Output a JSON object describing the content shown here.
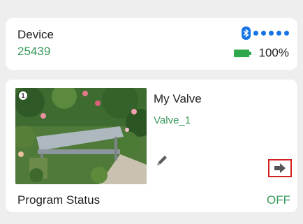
{
  "device": {
    "label": "Device",
    "id": "25439",
    "signal_bars": 5,
    "battery_level": "100%"
  },
  "valve": {
    "photo_badge": "1",
    "name": "My Valve",
    "id": "Valve_1",
    "program_status_label": "Program Status",
    "program_status_value": "OFF"
  },
  "icons": {
    "bluetooth": "bluetooth-icon",
    "battery": "battery-icon",
    "edit": "pencil-icon",
    "go": "arrow-right-icon"
  },
  "colors": {
    "accent_green": "#3a9a5c",
    "bluetooth_blue": "#1473e6",
    "highlight_red": "#d32020"
  }
}
